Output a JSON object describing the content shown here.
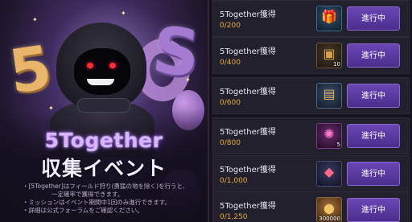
{
  "event": {
    "title": "5Together",
    "subtitle": "収集イベント",
    "notes": [
      "・[5Together]はフィールド狩り(勇猛の地を除く)を行うと、",
      "一定確率で獲得できます。",
      "・ミッションはイベント期間中1回のみ進行できます。",
      "・詳細は公式フォーラムをご確認ください。"
    ]
  },
  "balloons": {
    "left": "5",
    "right": "S"
  },
  "missions": [
    {
      "title": "5Together獲得",
      "progress": "0/200",
      "reward_icon": "gift-box-icon",
      "reward_qty": "",
      "button": "進行中"
    },
    {
      "title": "5Together獲得",
      "progress": "0/400",
      "reward_icon": "treasure-chest-icon",
      "reward_qty": "10",
      "button": "進行中"
    },
    {
      "title": "5Together獲得",
      "progress": "0/600",
      "reward_icon": "treasure-box-icon",
      "reward_qty": "",
      "button": "進行中"
    },
    {
      "title": "5Together獲得",
      "progress": "0/800",
      "reward_icon": "magic-orb-icon",
      "reward_qty": "5",
      "button": "進行中"
    },
    {
      "title": "5Together獲得",
      "progress": "0/1,000",
      "reward_icon": "jewel-pile-icon",
      "reward_qty": "",
      "button": "進行中"
    },
    {
      "title": "5Together獲得",
      "progress": "0/1,250",
      "reward_icon": "gold-coin-icon",
      "reward_qty": "300000",
      "button": "進行中"
    }
  ]
}
